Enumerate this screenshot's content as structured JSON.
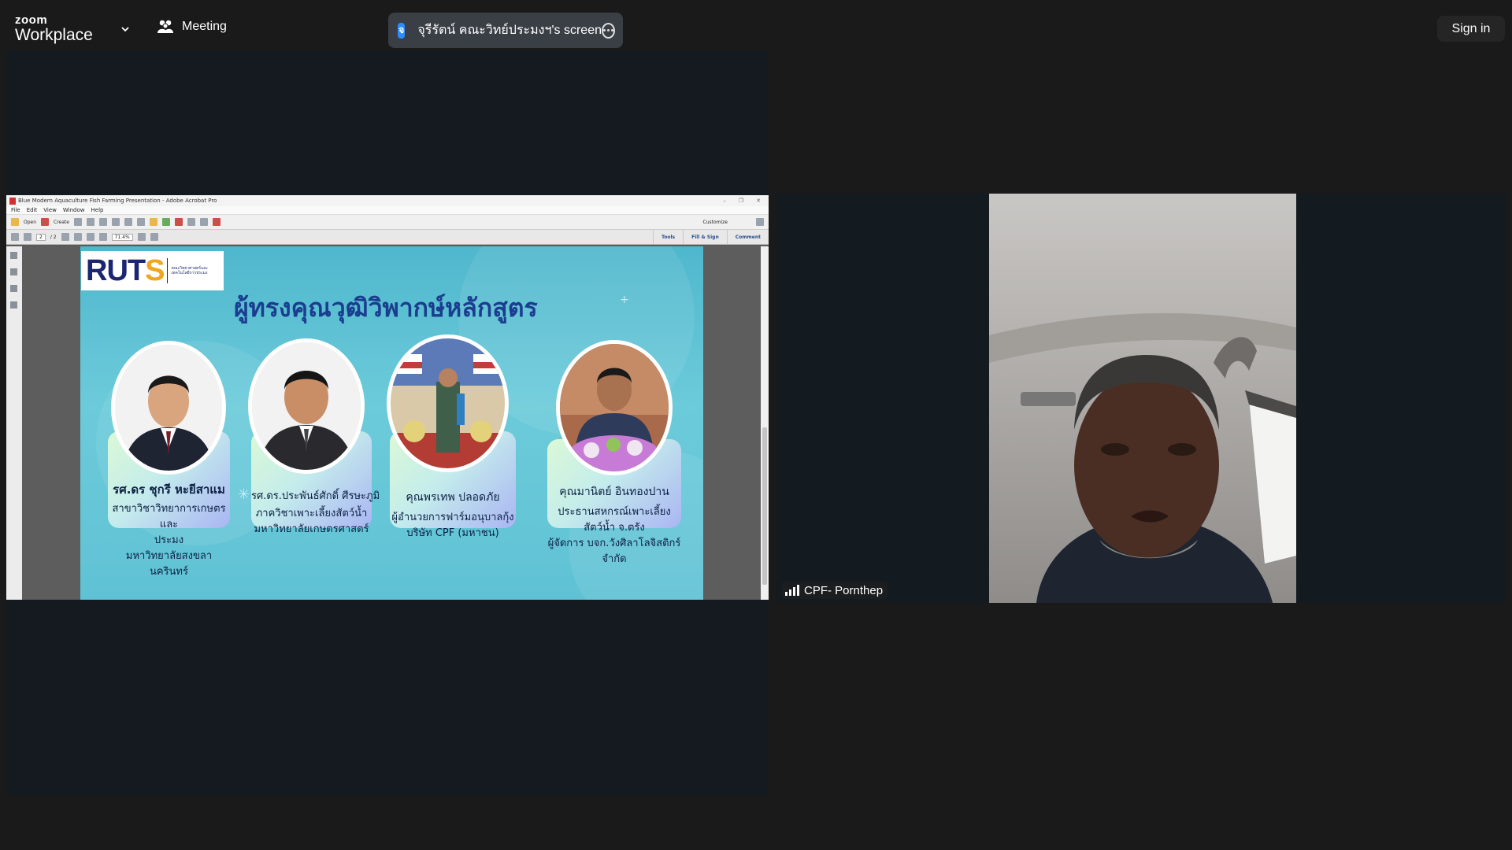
{
  "topbar": {
    "logo_small": "zoom",
    "logo_big": "Workplace",
    "meeting_label": "Meeting",
    "share_badge": "จ",
    "share_label": "จุรีรัตน์ คณะวิทย์ประมงฯ's screen",
    "signin_label": "Sign in"
  },
  "acrobat": {
    "window_title": "Blue Modern Aquaculture Fish Farming Presentation - Adobe Acrobat Pro",
    "menu": [
      "File",
      "Edit",
      "View",
      "Window",
      "Help"
    ],
    "toolbar": {
      "open": "Open",
      "create": "Create",
      "customize": "Customize"
    },
    "nav": {
      "page_current": "2",
      "page_total": "/ 2",
      "zoom": "71.4%"
    },
    "tools": [
      "Tools",
      "Fill & Sign",
      "Comment"
    ]
  },
  "slide": {
    "logo_text_main": "RUT",
    "logo_text_accent": "S",
    "logo_subtitle": "คณะวิทยาศาสตร์และเทคโนโลยีการประมง",
    "title": "ผู้ทรงคุณวุฒิวิพากษ์หลักสูตร",
    "experts": [
      {
        "name": "รศ.ดร ชุกรี หะยีสาแม",
        "desc": [
          "สาขาวิชาวิทยาการเกษตรและ",
          "ประมง",
          "มหาวิทยาลัยสงขลานครินทร์"
        ]
      },
      {
        "name": "รศ.ดร.ประพันธ์ศักดิ์ ศีรษะภูมิ",
        "desc": [
          "ภาควิชาเพาะเลี้ยงสัตว์น้ำ",
          "มหาวิทยาลัยเกษตรศาสตร์"
        ]
      },
      {
        "name": "คุณพรเทพ ปลอดภัย",
        "desc": [
          "ผู้อำนวยการฟาร์มอนุบาลกุ้ง",
          "บริษัท CPF (มหาชน)"
        ]
      },
      {
        "name": "คุณมานิตย์ อินทองปาน",
        "desc": [
          "ประธานสหกรณ์เพาะเลี้ยง",
          "สัตว์น้ำ จ.ตรัง",
          "ผู้จัดการ บจก.วังศิลาโลจิสติกร์",
          "จำกัด"
        ]
      }
    ]
  },
  "video": {
    "participant_name": "CPF- Pornthep"
  },
  "colors": {
    "accent_blue": "#2d8cff",
    "slide_title": "#1b3d8f",
    "ruts_navy": "#1b2670",
    "ruts_gold": "#f2a51e"
  }
}
